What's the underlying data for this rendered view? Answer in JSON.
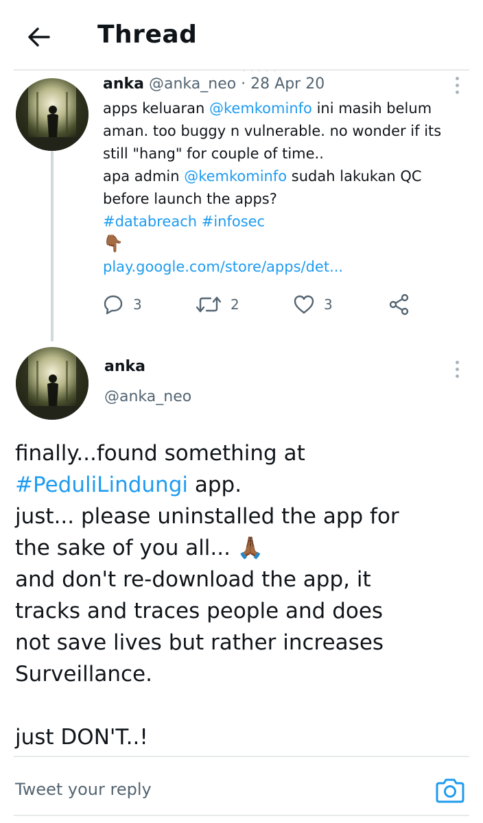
{
  "header": {
    "title": "Thread",
    "back_icon": "arrow-left-icon"
  },
  "tweet1": {
    "name": "anka",
    "handle": "@anka_neo",
    "separator": " · ",
    "date": "28 Apr 20",
    "lines": [
      [
        {
          "t": "apps keluaran "
        },
        {
          "t": "@kemkominfo",
          "link": true
        },
        {
          "t": " ini masih belum"
        }
      ],
      [
        {
          "t": "aman. too buggy n vulnerable. no wonder if its"
        }
      ],
      [
        {
          "t": "still \"hang\" for couple of time.."
        }
      ],
      [
        {
          "t": "apa admin "
        },
        {
          "t": "@kemkominfo",
          "link": true
        },
        {
          "t": " sudah lakukan QC"
        }
      ],
      [
        {
          "t": "before launch the apps?"
        }
      ],
      [
        {
          "t": "#databreach #infosec",
          "link": true
        }
      ],
      [
        {
          "t": "👇🏾",
          "emoji": true
        }
      ],
      [
        {
          "t": "play.google.com/store/apps/det...",
          "link": true
        }
      ]
    ],
    "reply_count": "3",
    "retweet_count": "2",
    "like_count": "3"
  },
  "tweet2": {
    "name": "anka",
    "handle": "@anka_neo",
    "lines": [
      [
        {
          "t": "finally...found something at"
        }
      ],
      [
        {
          "t": "#PeduliLindungi",
          "link": true
        },
        {
          "t": " app."
        }
      ],
      [
        {
          "t": "just... please uninstalled the app for"
        }
      ],
      [
        {
          "t": "the sake of you all... 🙏🏾"
        }
      ],
      [
        {
          "t": "and don't re-download the app, it"
        }
      ],
      [
        {
          "t": "tracks and traces people and does"
        }
      ],
      [
        {
          "t": "not save lives but rather increases"
        }
      ],
      [
        {
          "t": "Surveillance."
        }
      ],
      [
        {
          "t": ""
        }
      ],
      [
        {
          "t": "just DON'T..!"
        }
      ]
    ]
  },
  "reply": {
    "placeholder": "Tweet your reply"
  },
  "colors": {
    "link": "#1d9bf0",
    "text": "#0f1419",
    "muted": "#536471",
    "divider": "#e7e9ea"
  }
}
